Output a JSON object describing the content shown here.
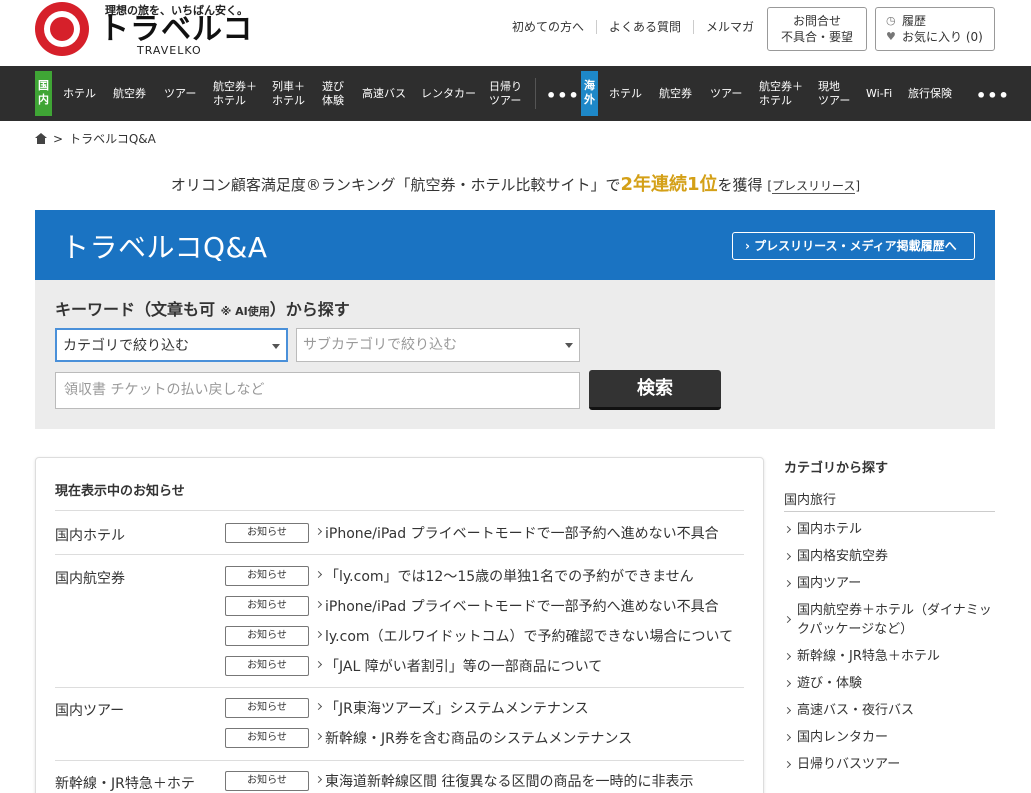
{
  "header": {
    "logo_tagline": "理想の旅を、いちばん安く。",
    "logo_name": "トラベルコ",
    "logo_sub": "TRAVELKO",
    "links": [
      "初めての方へ",
      "よくある質問",
      "メルマガ"
    ],
    "contact_line1": "お問合せ",
    "contact_line2": "不具合・要望",
    "history_label": "履歴",
    "favorites_label": "お気に入り (0)"
  },
  "nav": {
    "domestic_badge": "国\n内",
    "overseas_badge": "海\n外",
    "domestic_items": [
      "ホテル",
      "航空券",
      "ツアー",
      "航空券＋\nホテル",
      "列車＋\nホテル",
      "遊び\n体験",
      "高速バス",
      "レンタカー",
      "日帰り\nツアー"
    ],
    "overseas_items": [
      "ホテル",
      "航空券",
      "ツアー",
      "航空券＋\nホテル",
      "現地\nツアー",
      "Wi-Fi",
      "旅行保険"
    ],
    "more": "•••"
  },
  "breadcrumb": {
    "separator": ">",
    "current": "トラベルコQ&A"
  },
  "award": {
    "prefix": "オリコン顧客満足度®ランキング「航空券・ホテル比較サイト」で",
    "highlight": "2年連続1位",
    "suffix": "を獲得",
    "press_link": "プレスリリース"
  },
  "banner": {
    "title": "トラベルコQ&A",
    "button": "プレスリリース・メディア掲載履歴へ"
  },
  "search": {
    "title": "キーワード（文章も可",
    "title_note": "※ AI使用",
    "title_end": "）から探す",
    "category_value": "カテゴリで絞り込む",
    "subcategory_placeholder": "サブカテゴリで絞り込む",
    "keyword_placeholder": "領収書 チケットの払い戻しなど",
    "button": "検索"
  },
  "notices": {
    "title": "現在表示中のお知らせ",
    "tag": "お知らせ",
    "groups": [
      {
        "label": "国内ホテル",
        "items": [
          "iPhone/iPad プライベートモードで一部予約へ進めない不具合"
        ]
      },
      {
        "label": "国内航空券",
        "items": [
          "「ly.com」では12〜15歳の単独1名での予約ができません",
          "iPhone/iPad プライベートモードで一部予約へ進めない不具合",
          "ly.com（エルワイドットコム）で予約確認できない場合について",
          "「JAL 障がい者割引」等の一部商品について"
        ]
      },
      {
        "label": "国内ツアー",
        "items": [
          "「JR東海ツアーズ」システムメンテナンス",
          "新幹線・JR券を含む商品のシステムメンテナンス"
        ]
      },
      {
        "label": "新幹線・JR特急＋ホテ",
        "items": [
          "東海道新幹線区間 往復異なる区間の商品を一時的に非表示"
        ]
      }
    ]
  },
  "sidebar": {
    "title": "カテゴリから探す",
    "section": "国内旅行",
    "items": [
      "国内ホテル",
      "国内格安航空券",
      "国内ツアー",
      "国内航空券＋ホテル（ダイナミックパッケージなど）",
      "新幹線・JR特急＋ホテル",
      "遊び・体験",
      "高速バス・夜行バス",
      "国内レンタカー",
      "日帰りバスツアー"
    ]
  }
}
